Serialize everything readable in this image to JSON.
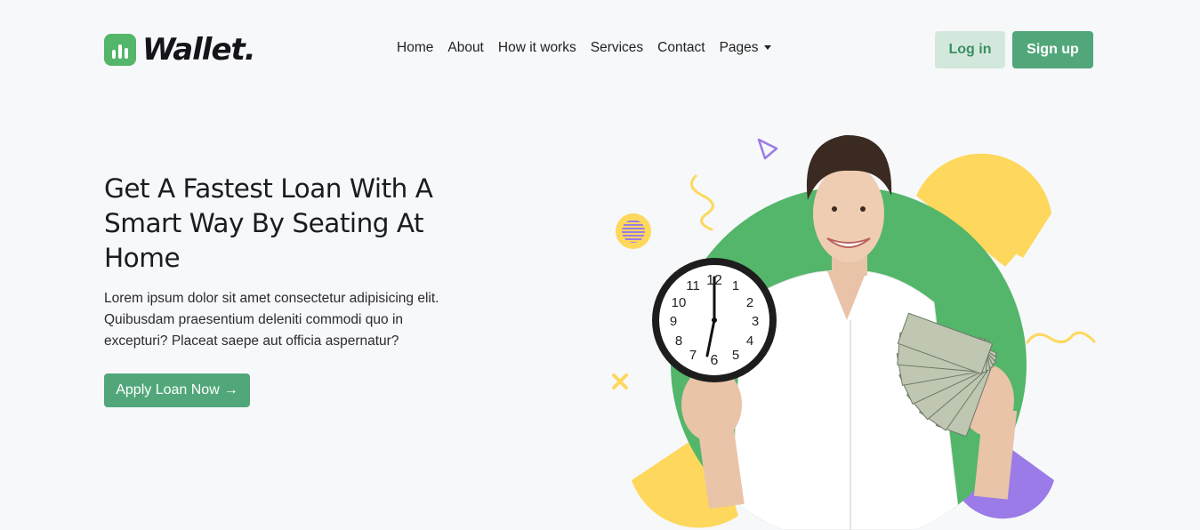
{
  "brand": {
    "name": "Wallet.",
    "accent": "#52a77a",
    "logo_green": "#53b66a"
  },
  "nav": {
    "items": [
      "Home",
      "About",
      "How it works",
      "Services",
      "Contact"
    ],
    "dropdown_label": "Pages"
  },
  "header": {
    "login_label": "Log in",
    "signup_label": "Sign up"
  },
  "hero": {
    "title": "Get A Fastest Loan With A Smart Way By Seating At Home",
    "text": "Lorem ipsum dolor sit amet consectetur adipisicing elit. Quibusdam praesentium deleniti commodi quo in excepturi? Placeat saepe aut officia aspernatur?",
    "cta_label": "Apply Loan Now",
    "cta_icon": "arrow-right-icon"
  },
  "illustration": {
    "colors": {
      "green": "#53b66a",
      "yellow": "#fdd85d",
      "purple": "#9b7be8"
    },
    "clock_numbers": [
      "12",
      "1",
      "2",
      "3",
      "4",
      "5",
      "6",
      "7",
      "8",
      "9",
      "10",
      "11"
    ]
  }
}
